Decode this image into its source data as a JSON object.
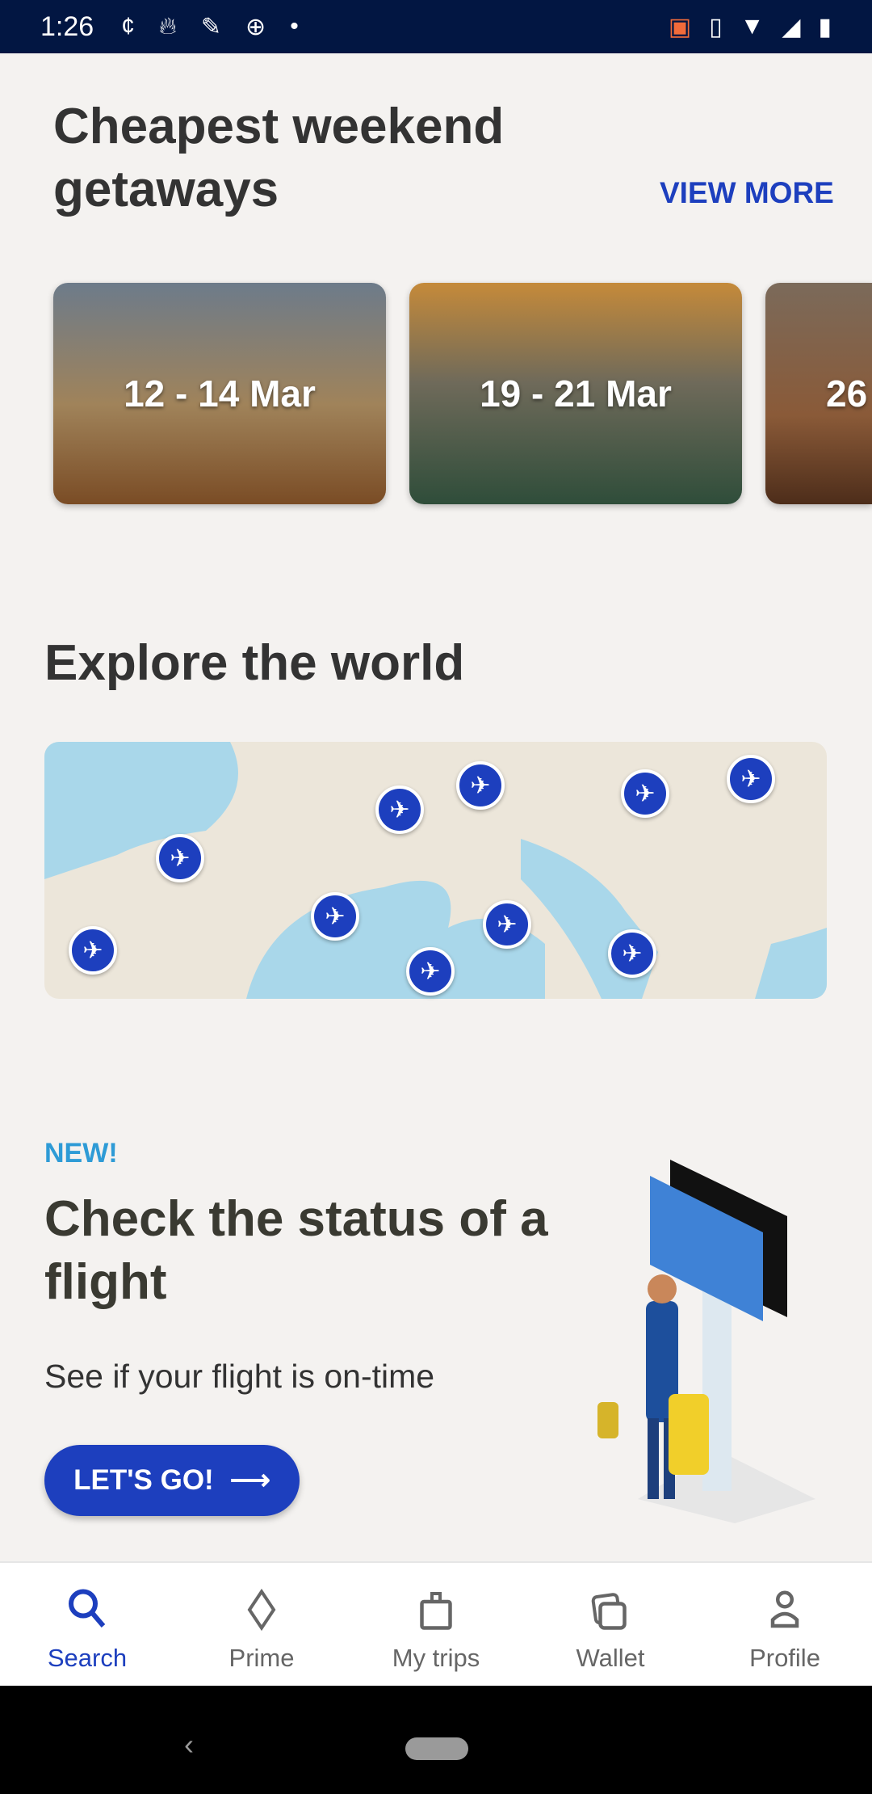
{
  "status_bar": {
    "time": "1:26"
  },
  "getaways": {
    "title": "Cheapest weekend getaways",
    "view_more": "VIEW MORE",
    "cards": [
      {
        "dates": "12 - 14 Mar"
      },
      {
        "dates": "19 - 21 Mar"
      },
      {
        "dates": "26"
      }
    ]
  },
  "explore": {
    "title": "Explore the world"
  },
  "flight_status": {
    "badge": "NEW!",
    "title": "Check the status of a flight",
    "subtitle": "See if your flight is on-time",
    "button": "LET'S GO!"
  },
  "nav": {
    "items": [
      {
        "label": "Search",
        "active": true
      },
      {
        "label": "Prime"
      },
      {
        "label": "My trips"
      },
      {
        "label": "Wallet"
      },
      {
        "label": "Profile"
      }
    ]
  },
  "colors": {
    "accent": "#1d3fbe",
    "status_bar": "#021642",
    "new_badge": "#2e9bd6"
  }
}
